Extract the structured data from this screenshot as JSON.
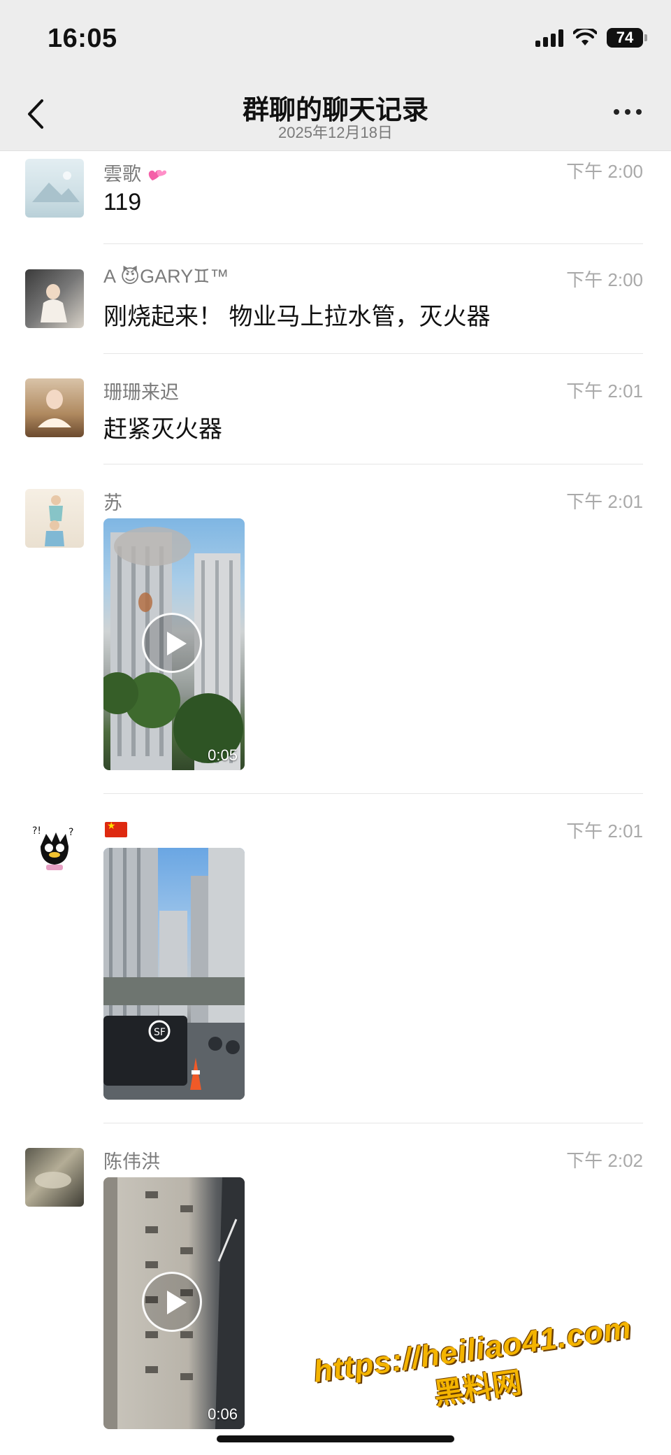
{
  "status_bar": {
    "time": "16:05",
    "battery": "74"
  },
  "header": {
    "title": "群聊的聊天记录",
    "subtitle": "2025年12月18日"
  },
  "messages": [
    {
      "sender": "雲歌",
      "time": "下午 2:00",
      "text": "119"
    },
    {
      "sender": "A   😈GARY♊™",
      "time": "下午 2:00",
      "text": "刚烧起来！ 物业马上拉水管，灭火器"
    },
    {
      "sender": "珊珊来迟",
      "time": "下午 2:01",
      "text": "赶紧灭火器"
    },
    {
      "sender": "苏",
      "time": "下午 2:01",
      "video_duration": "0:05"
    },
    {
      "sender": "",
      "time": "下午 2:01"
    },
    {
      "sender": "陈伟洪",
      "time": "下午 2:02",
      "video_duration": "0:06"
    }
  ],
  "watermark": {
    "url": "https://heiliao41.com",
    "name": "黑料网"
  },
  "colors": {
    "header_bg": "#ededed",
    "time_gray": "#a9a9a9",
    "sender_gray": "#7b7b7b",
    "watermark": "#f4b400"
  },
  "icons": [
    "back-chevron-icon",
    "more-dots-icon",
    "signal-icon",
    "wifi-icon",
    "battery-icon",
    "play-icon",
    "heart-emoji-icon",
    "china-flag-icon"
  ]
}
